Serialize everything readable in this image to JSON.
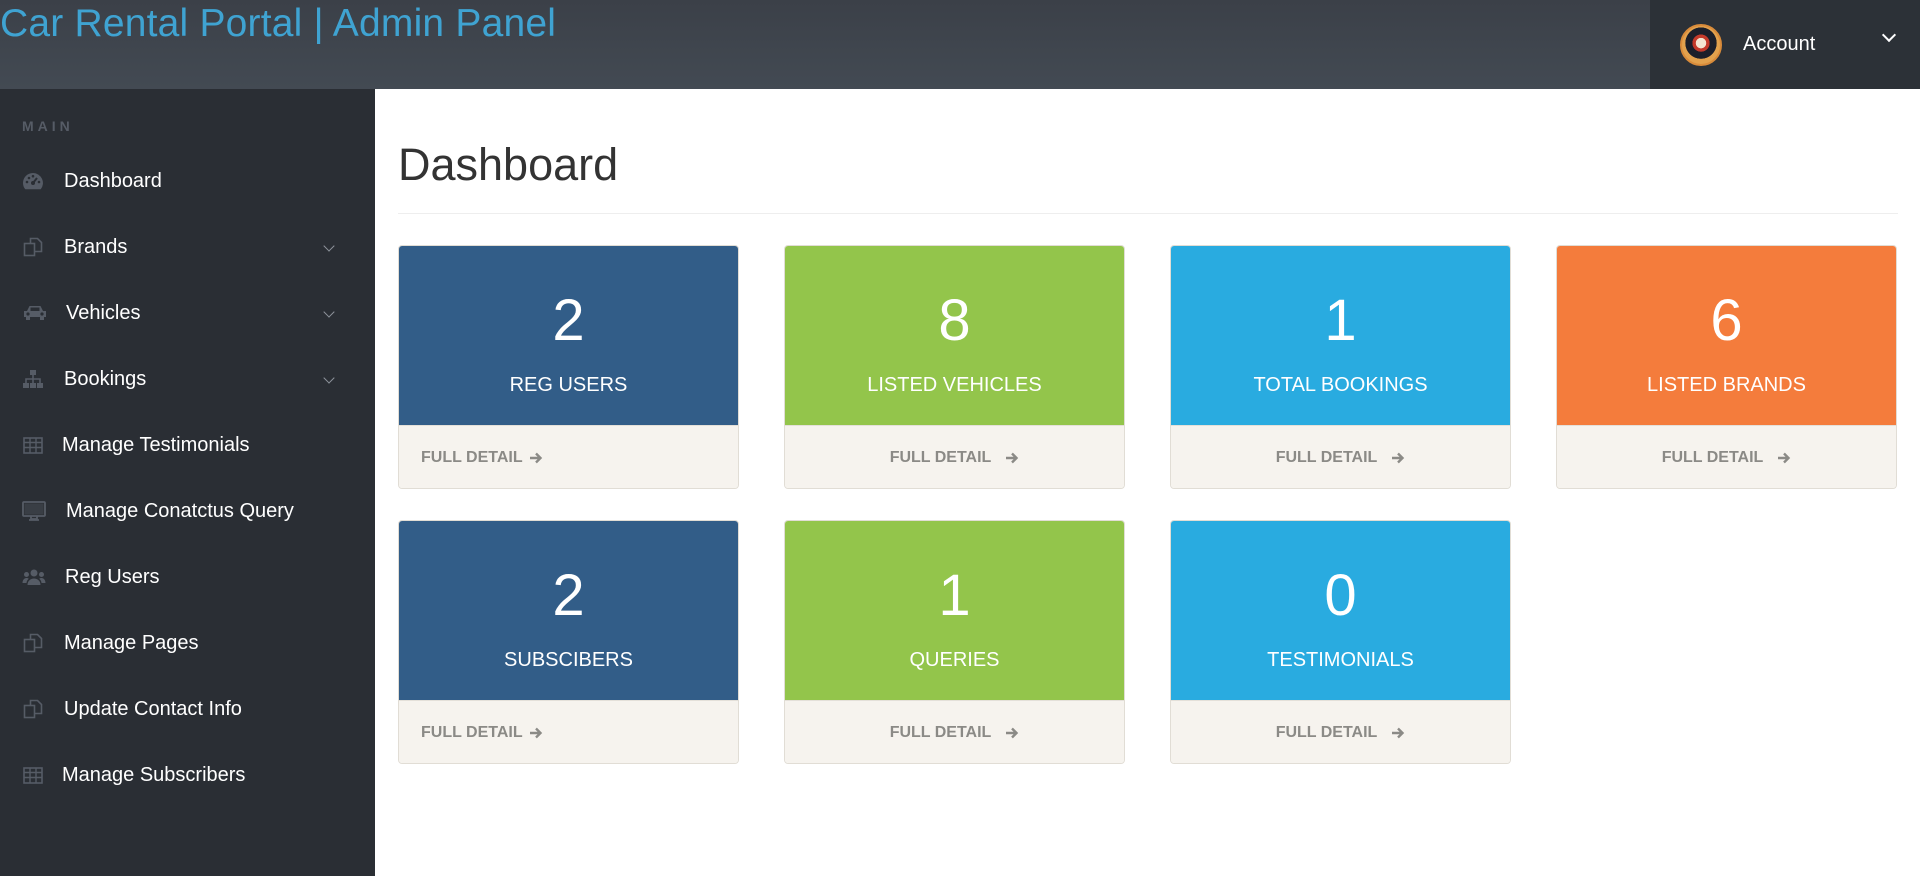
{
  "header": {
    "brand": "Car Rental Portal | Admin Panel",
    "account_label": "Account"
  },
  "sidebar": {
    "heading": "MAIN",
    "items": [
      {
        "label": "Dashboard",
        "icon": "dashboard-icon",
        "has_submenu": false
      },
      {
        "label": "Brands",
        "icon": "files-icon",
        "has_submenu": true
      },
      {
        "label": "Vehicles",
        "icon": "car-icon",
        "has_submenu": true
      },
      {
        "label": "Bookings",
        "icon": "sitemap-icon",
        "has_submenu": true
      },
      {
        "label": "Manage Testimonials",
        "icon": "table-icon",
        "has_submenu": false
      },
      {
        "label": "Manage Conatctus Query",
        "icon": "desktop-icon",
        "has_submenu": false
      },
      {
        "label": "Reg Users",
        "icon": "users-icon",
        "has_submenu": false
      },
      {
        "label": "Manage Pages",
        "icon": "files-icon",
        "has_submenu": false
      },
      {
        "label": "Update Contact Info",
        "icon": "files-icon",
        "has_submenu": false
      },
      {
        "label": "Manage Subscribers",
        "icon": "table-icon",
        "has_submenu": false
      }
    ]
  },
  "main": {
    "title": "Dashboard",
    "cards": [
      {
        "count": "2",
        "label": "REG USERS",
        "link": "FULL DETAIL",
        "color": "#325d88"
      },
      {
        "count": "8",
        "label": "LISTED VEHICLES",
        "link": "FULL DETAIL",
        "color": "#93c54b"
      },
      {
        "count": "1",
        "label": "TOTAL BOOKINGS",
        "link": "FULL DETAIL",
        "color": "#29abe0"
      },
      {
        "count": "6",
        "label": "LISTED BRANDS",
        "link": "FULL DETAIL",
        "color": "#f47c3c"
      },
      {
        "count": "2",
        "label": "SUBSCIBERS",
        "link": "FULL DETAIL",
        "color": "#325d88"
      },
      {
        "count": "1",
        "label": "QUERIES",
        "link": "FULL DETAIL",
        "color": "#93c54b"
      },
      {
        "count": "0",
        "label": "TESTIMONIALS",
        "link": "FULL DETAIL",
        "color": "#29abe0"
      }
    ]
  },
  "colors": {
    "brand_text": "#3fa3d2",
    "sidebar_bg": "#2a2e34",
    "topbar_bg": "#3f454d"
  }
}
